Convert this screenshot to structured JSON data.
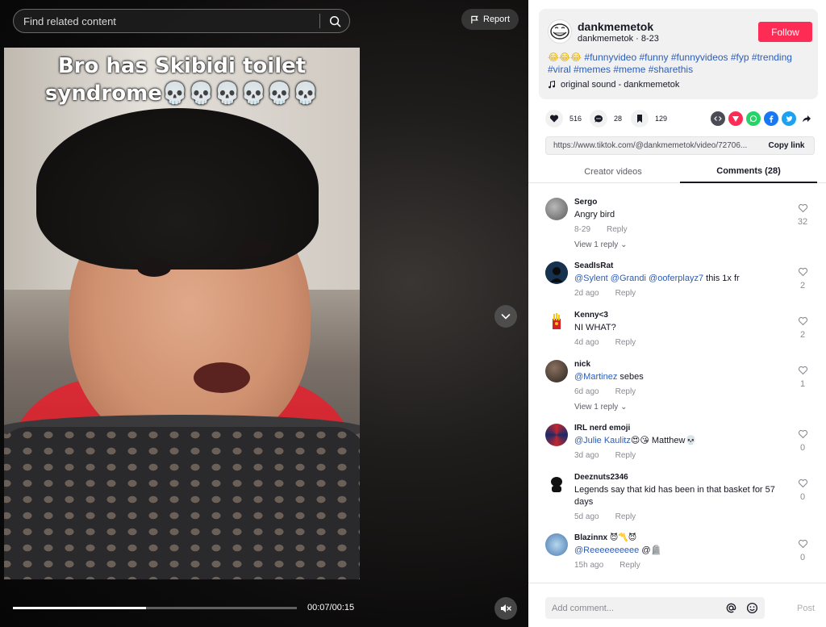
{
  "player": {
    "search_placeholder": "Find related content",
    "report_label": "Report",
    "caption_line1": "Bro has Skibidi toilet",
    "caption_line2": "syndrome💀💀💀💀💀💀",
    "time": "00:07/00:15",
    "progress": 0.47
  },
  "author": {
    "username": "dankmemetok",
    "handle": "dankmemetok",
    "date": "8-23",
    "follow_label": "Follow",
    "description_emoji": "😂😂😂",
    "hashtags": "#funnyvideo #funny #funnyvideos #fyp #trending #viral #memes #meme #sharethis",
    "sound": "original sound - dankmemetok"
  },
  "stats": {
    "likes": "516",
    "comments": "28",
    "saves": "129"
  },
  "share_icons": [
    "embed-icon",
    "send-icon",
    "whatsapp-icon",
    "facebook-icon",
    "twitter-icon",
    "share-arrow-icon"
  ],
  "colors": {
    "accent": "#fe2c55",
    "link": "#2b5db9",
    "whatsapp": "#25d366",
    "facebook": "#1877f2",
    "twitter": "#1da1f2"
  },
  "link": {
    "url": "https://www.tiktok.com/@dankmemetok/video/72706...",
    "copy_label": "Copy link"
  },
  "tabs": {
    "creator": "Creator videos",
    "comments": "Comments (28)"
  },
  "comments": [
    {
      "user": "Sergo",
      "text": "Angry bird",
      "mentions": "",
      "time": "8-29",
      "reply": "Reply",
      "likes": "32",
      "view_replies": "View 1 reply"
    },
    {
      "user": "SeadIsRat",
      "mentions": "@Sylent @Grandi @ooferplayz7",
      "text": " this 1x fr",
      "time": "2d ago",
      "reply": "Reply",
      "likes": "2",
      "view_replies": ""
    },
    {
      "user": "Kenny<3",
      "mentions": "",
      "text": "NI WHAT?",
      "time": "4d ago",
      "reply": "Reply",
      "likes": "2",
      "view_replies": ""
    },
    {
      "user": "nick",
      "mentions": "@Martinez",
      "text": " sebes",
      "time": "6d ago",
      "reply": "Reply",
      "likes": "1",
      "view_replies": "View 1 reply"
    },
    {
      "user": "IRL nerd emoji",
      "mentions": "@Julie Kaulitz",
      "text": "😍😘 Matthew💀",
      "time": "3d ago",
      "reply": "Reply",
      "likes": "0",
      "view_replies": ""
    },
    {
      "user": "Deeznuts2346",
      "mentions": "",
      "text": "Legends say that kid has been in that basket for 57 days",
      "time": "5d ago",
      "reply": "Reply",
      "likes": "0",
      "view_replies": ""
    },
    {
      "user": "Blazinnx 😈〽️😈",
      "mentions": "@Reeeeeeeeee",
      "text": " @🪦",
      "time": "15h ago",
      "reply": "Reply",
      "likes": "0",
      "view_replies": ""
    }
  ],
  "composer": {
    "placeholder": "Add comment...",
    "post_label": "Post"
  }
}
